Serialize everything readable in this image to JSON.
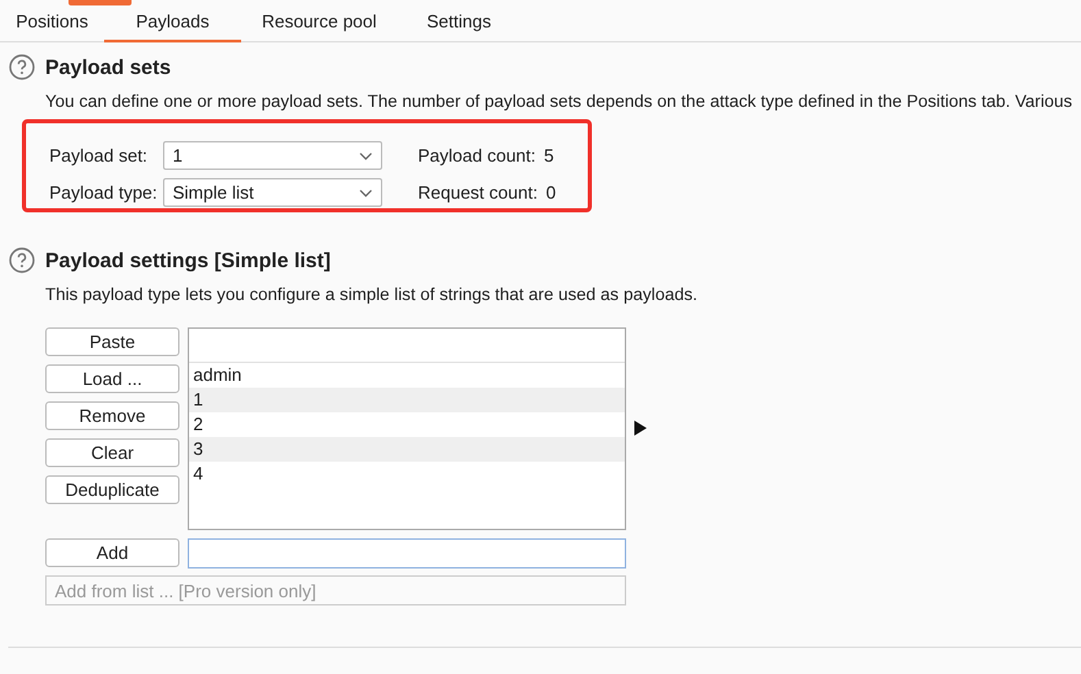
{
  "tabs": [
    {
      "label": "Positions",
      "selected": false
    },
    {
      "label": "Payloads",
      "selected": true
    },
    {
      "label": "Resource pool",
      "selected": false
    },
    {
      "label": "Settings",
      "selected": false
    }
  ],
  "payload_sets": {
    "title": "Payload sets",
    "description": "You can define one or more payload sets. The number of payload sets depends on the attack type defined in the Positions tab. Various",
    "highlighted": true,
    "fields": [
      {
        "label": "Payload set:",
        "value": "1",
        "count_label": "Payload count:",
        "count": "5"
      },
      {
        "label": "Payload type:",
        "value": "Simple list",
        "count_label": "Request count:",
        "count": "0"
      }
    ]
  },
  "payload_settings": {
    "title": "Payload settings [Simple list]",
    "description": "This payload type lets you configure a simple list of strings that are used as payloads.",
    "buttons": [
      "Paste",
      "Load ...",
      "Remove",
      "Clear",
      "Deduplicate"
    ],
    "items": [
      "admin",
      "1",
      "2",
      "3",
      "4"
    ],
    "add_button": "Add",
    "add_from_list": {
      "placeholder": "Add from list ... [Pro version only]",
      "disabled": true
    }
  }
}
